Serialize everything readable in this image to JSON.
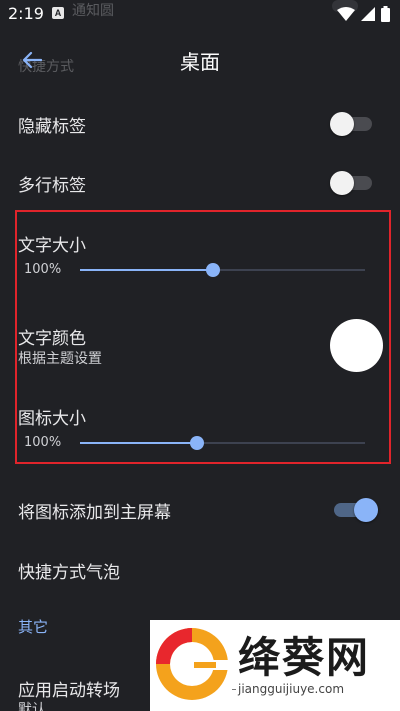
{
  "status_bar": {
    "time": "2:19",
    "notification_glyph": "A",
    "ghost_text": "通知圆",
    "icons": [
      "wifi-icon",
      "signal-icon",
      "battery-icon"
    ]
  },
  "app_bar": {
    "title": "桌面",
    "ghost_text": "快捷方式",
    "back_icon": "arrow-back-icon"
  },
  "settings": {
    "hide_labels": {
      "label": "隐藏标签",
      "checked": false
    },
    "multiline_labels": {
      "label": "多行标签",
      "checked": false
    },
    "text_size": {
      "label": "文字大小",
      "value": "100%",
      "level": 0.465
    },
    "text_color": {
      "label": "文字颜色",
      "subtitle": "根据主题设置",
      "color": "#ffffff"
    },
    "icon_size": {
      "label": "图标大小",
      "value": "100%",
      "level": 0.41
    },
    "add_icon_to_home": {
      "label": "将图标添加到主屏幕",
      "checked": true
    },
    "shortcut_bubble": {
      "label": "快捷方式气泡"
    }
  },
  "other_section": {
    "header": "其它",
    "app_transition": {
      "label": "应用启动转场",
      "subtitle": "默认"
    }
  },
  "watermark": {
    "text": "绛葵网",
    "url": "jiangguijiuye.com"
  },
  "colors": {
    "background": "#202125",
    "accent": "#8ab4f8",
    "highlight": "#e0242b"
  }
}
